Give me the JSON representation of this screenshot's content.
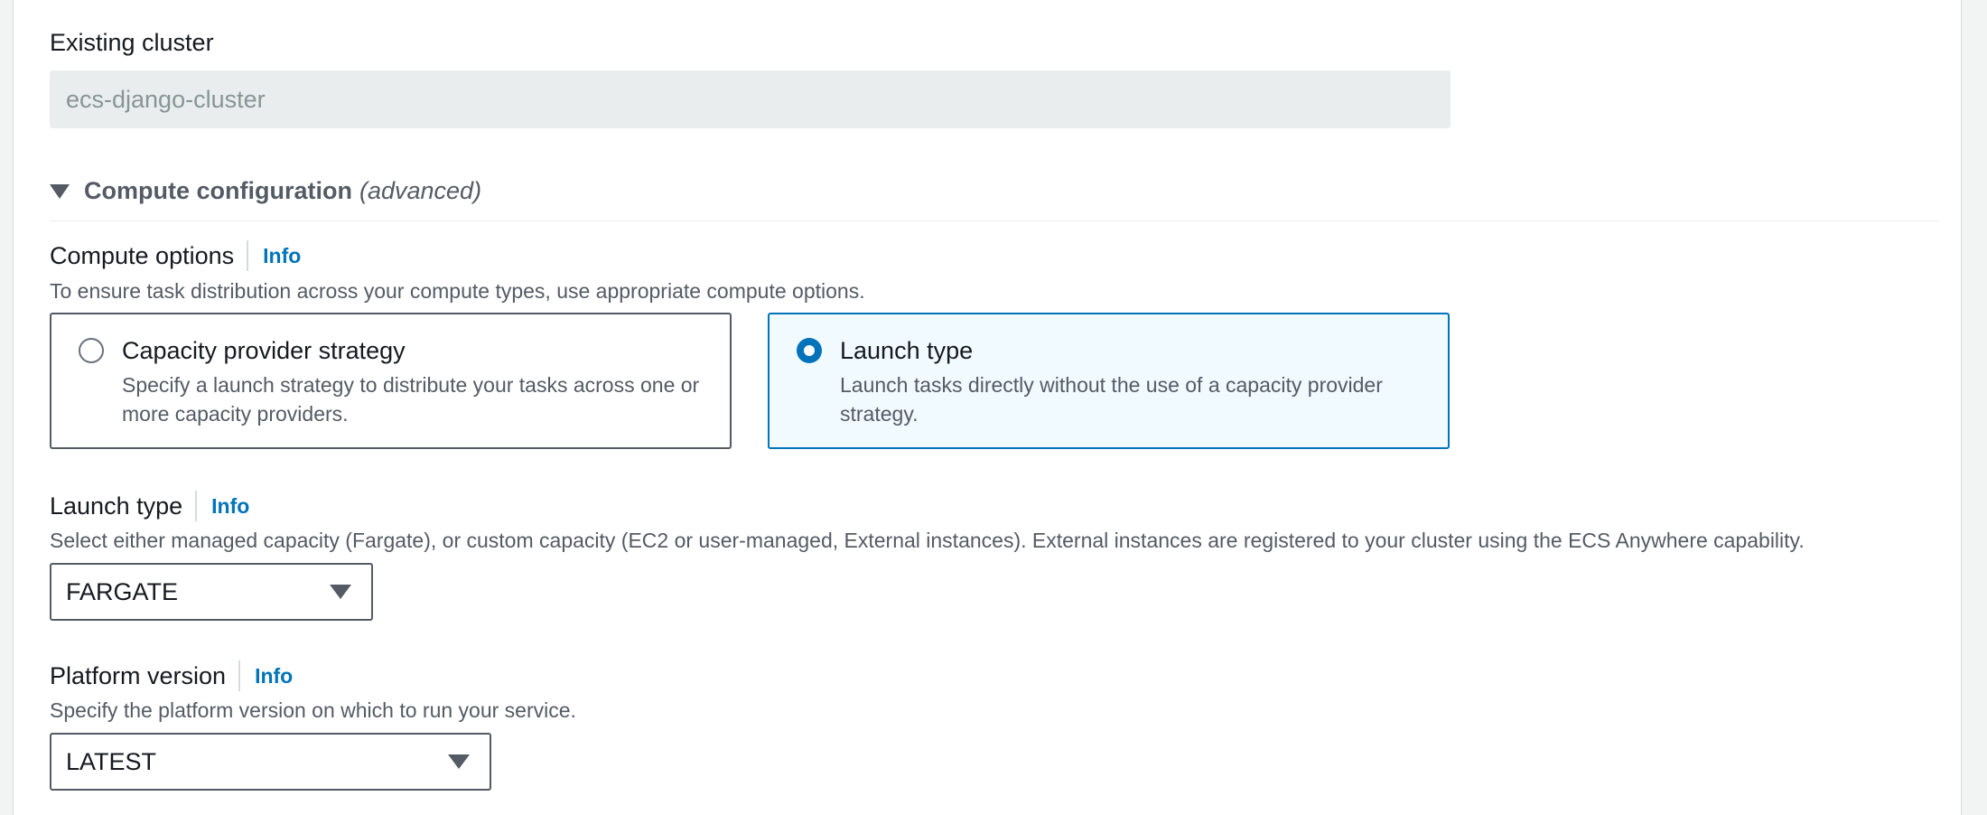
{
  "existing_cluster": {
    "label": "Existing cluster",
    "value": "ecs-django-cluster"
  },
  "compute_configuration": {
    "title": "Compute configuration",
    "title_suffix": "(advanced)",
    "expanded": true
  },
  "compute_options": {
    "label": "Compute options",
    "info": "Info",
    "description": "To ensure task distribution across your compute types, use appropriate compute options.",
    "selected": "launch_type",
    "options": [
      {
        "id": "capacity_provider_strategy",
        "title": "Capacity provider strategy",
        "description": "Specify a launch strategy to distribute your tasks across one or more capacity providers."
      },
      {
        "id": "launch_type",
        "title": "Launch type",
        "description": "Launch tasks directly without the use of a capacity provider strategy."
      }
    ]
  },
  "launch_type": {
    "label": "Launch type",
    "info": "Info",
    "description": "Select either managed capacity (Fargate), or custom capacity (EC2 or user-managed, External instances). External instances are registered to your cluster using the ECS Anywhere capability.",
    "value": "FARGATE"
  },
  "platform_version": {
    "label": "Platform version",
    "info": "Info",
    "description": "Specify the platform version on which to run your service.",
    "value": "LATEST"
  },
  "colors": {
    "link": "#0073bb",
    "selected_border": "#0073bb",
    "selected_background": "#f1faff"
  }
}
